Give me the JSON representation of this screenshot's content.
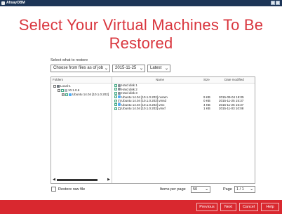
{
  "app": {
    "title": "AhsayOBM"
  },
  "page": {
    "title": "Select Your Virtual Machines To Be Restored"
  },
  "selector": {
    "label": "Select what to restore",
    "mode": "Choose from files as of job",
    "date": "2015-11-25",
    "version": "Latest"
  },
  "tree": {
    "header": "Folders",
    "nodes": [
      {
        "label": "Local-1"
      },
      {
        "label": "10.1.0.6"
      },
      {
        "label": "Ubuntu 14.04 [10.1.0.202]"
      }
    ]
  },
  "files": {
    "columns": {
      "name": "Name",
      "size": "Size",
      "date": "Date modified"
    },
    "rows": [
      {
        "name": "Hard disk 1",
        "size": "",
        "date": "",
        "icon": "disk-icon"
      },
      {
        "name": "Hard disk 2",
        "size": "",
        "date": "",
        "icon": "disk-icon"
      },
      {
        "name": "Hard disk 3",
        "size": "",
        "date": "",
        "icon": "disk-icon"
      },
      {
        "name": "Ubuntu 14.04 [10.1.0.202].nvram",
        "size": "9 KB",
        "date": "2015-09-04 19:05",
        "icon": "file-icon"
      },
      {
        "name": "Ubuntu 14.04 [10.1.0.202].vmsd",
        "size": "0 KB",
        "date": "2015-11-25 15:37",
        "icon": "file-icon"
      },
      {
        "name": "Ubuntu 14.04 [10.1.0.202].vmx",
        "size": "4 KB",
        "date": "2015-11-25 15:37",
        "icon": "file-icon"
      },
      {
        "name": "Ubuntu 14.04 [10.1.0.202].vmxf",
        "size": "1 KB",
        "date": "2015-11-03 10:08",
        "icon": "file-icon"
      }
    ]
  },
  "bottom": {
    "restore_raw": "Restore raw file",
    "items_per_page_label": "Items per page",
    "items_per_page": "50",
    "page_label": "Page",
    "page_value": "1 / 1"
  },
  "footer": {
    "previous": "Previous",
    "next": "Next",
    "cancel": "Cancel",
    "help": "Help"
  },
  "colors": {
    "accent": "#d9282f",
    "title": "#d9363e"
  }
}
